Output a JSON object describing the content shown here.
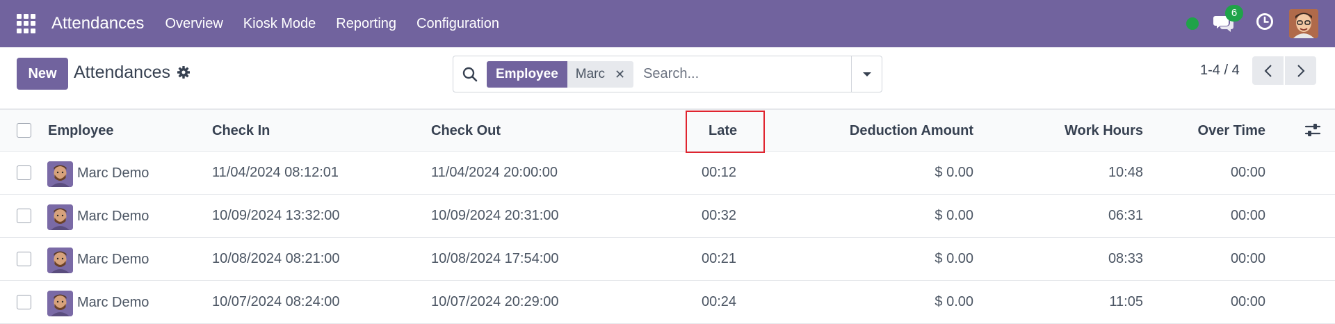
{
  "navbar": {
    "app_title": "Attendances",
    "menu": [
      "Overview",
      "Kiosk Mode",
      "Reporting",
      "Configuration"
    ],
    "chat_count": "6",
    "icons": [
      "apps-grid-icon",
      "presence-dot",
      "chat-icon",
      "clock-icon",
      "user-avatar"
    ]
  },
  "control": {
    "new_label": "New",
    "title": "Attendances",
    "search": {
      "facet_label": "Employee",
      "facet_value": "Marc",
      "placeholder": "Search..."
    },
    "pager": "1-4 / 4"
  },
  "table": {
    "columns": [
      "Employee",
      "Check In",
      "Check Out",
      "Late",
      "Deduction Amount",
      "Work Hours",
      "Over Time"
    ],
    "rows": [
      {
        "employee": "Marc Demo",
        "check_in": "11/04/2024 08:12:01",
        "check_out": "11/04/2024 20:00:00",
        "late": "00:12",
        "deduction": "$ 0.00",
        "work_hours": "10:48",
        "over_time": "00:00"
      },
      {
        "employee": "Marc Demo",
        "check_in": "10/09/2024 13:32:00",
        "check_out": "10/09/2024 20:31:00",
        "late": "00:32",
        "deduction": "$ 0.00",
        "work_hours": "06:31",
        "over_time": "00:00"
      },
      {
        "employee": "Marc Demo",
        "check_in": "10/08/2024 08:21:00",
        "check_out": "10/08/2024 17:54:00",
        "late": "00:21",
        "deduction": "$ 0.00",
        "work_hours": "08:33",
        "over_time": "00:00"
      },
      {
        "employee": "Marc Demo",
        "check_in": "10/07/2024 08:24:00",
        "check_out": "10/07/2024 20:29:00",
        "late": "00:24",
        "deduction": "$ 0.00",
        "work_hours": "11:05",
        "over_time": "00:00"
      }
    ]
  },
  "colors": {
    "brand": "#71639e",
    "online": "#1fa349",
    "highlight": "#e0242f"
  }
}
